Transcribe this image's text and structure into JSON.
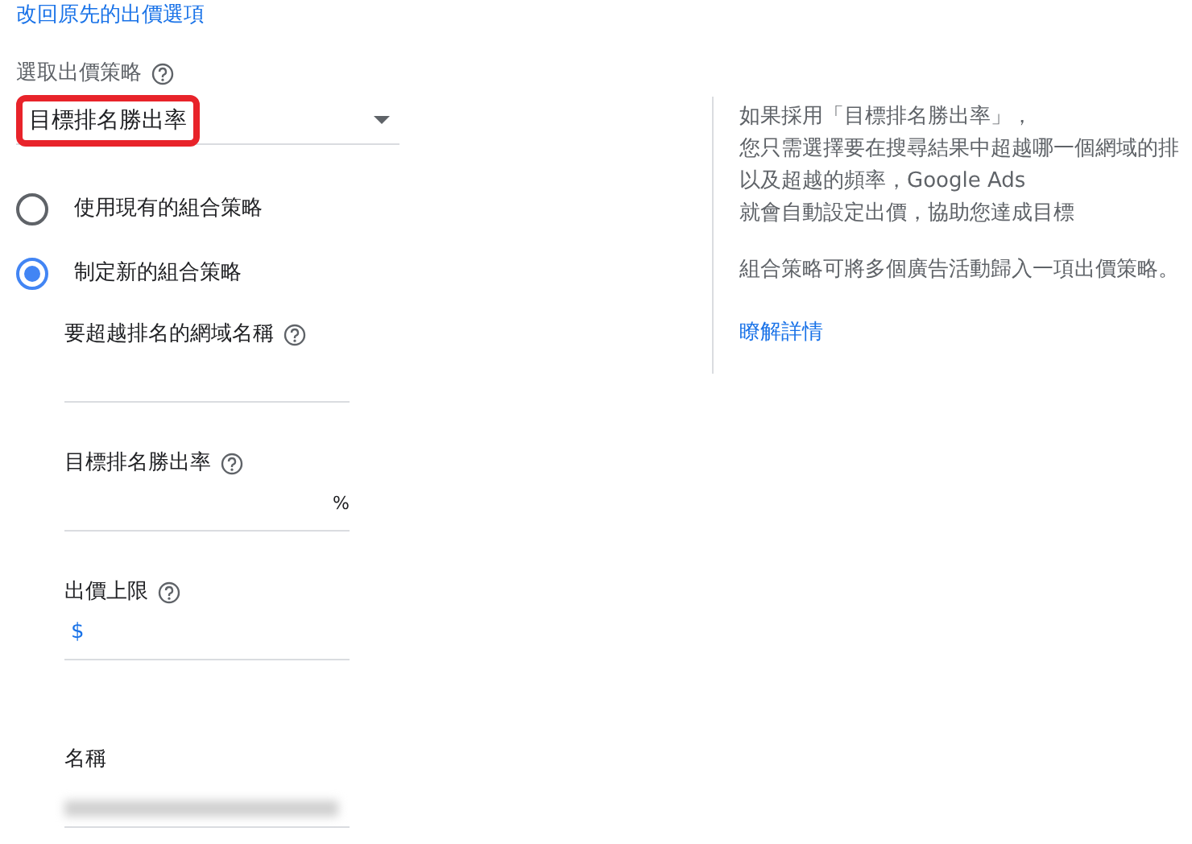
{
  "back_link": "改回原先的出價選項",
  "strategy_select": {
    "label": "選取出價策略",
    "value": "目標排名勝出率",
    "highlighted": true
  },
  "radios": [
    {
      "label": "使用現有的組合策略",
      "selected": false
    },
    {
      "label": "制定新的組合策略",
      "selected": true
    }
  ],
  "fields": [
    {
      "label": "要超越排名的網域名稱",
      "help": true
    },
    {
      "label": "目標排名勝出率",
      "help": true,
      "suffix": "%"
    },
    {
      "label": "出價上限",
      "help": true,
      "prefix": "$"
    },
    {
      "label": "名稱",
      "help": false,
      "blurred": true
    }
  ],
  "info": {
    "paragraphs": [
      [
        "如果採用「目標排名勝出率」，",
        "您只需選擇要在搜尋結果中超越哪一個網域的排",
        "以及超越的頻率，Google Ads",
        "就會自動設定出價，協助您達成目標"
      ],
      [
        "組合策略可將多個廣告活動歸入一項出價策略。"
      ]
    ],
    "link": "瞭解詳情"
  }
}
